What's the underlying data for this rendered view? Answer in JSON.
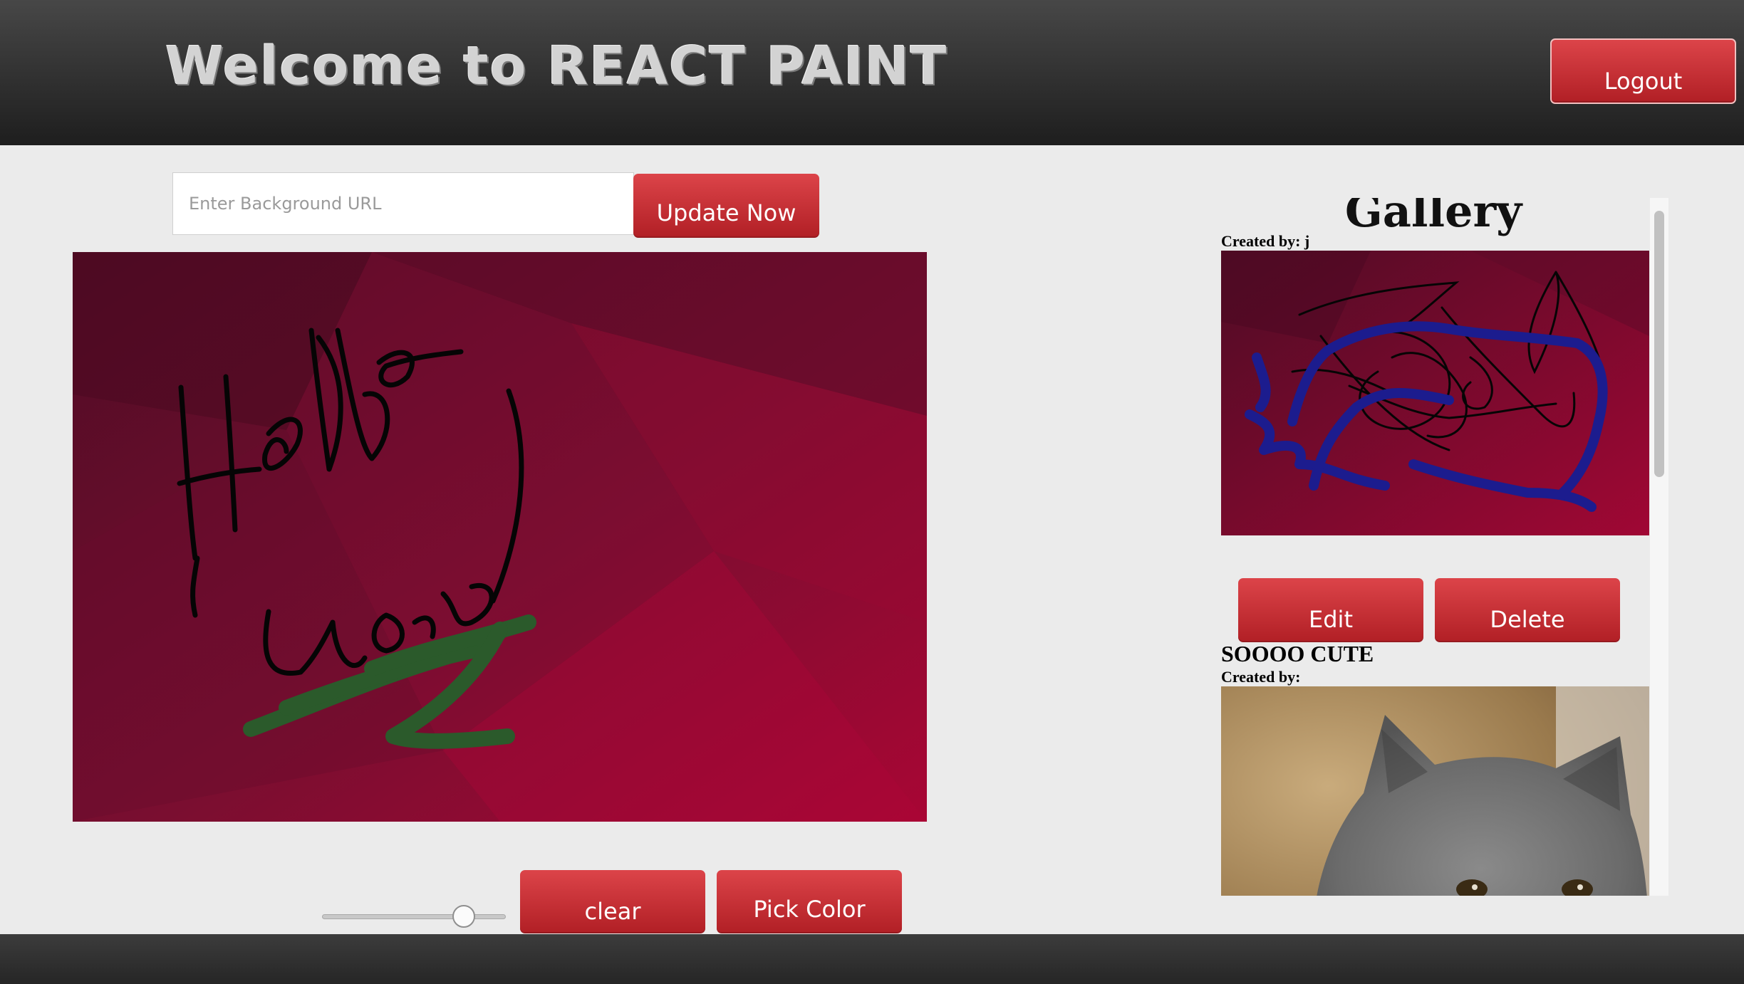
{
  "header": {
    "title": "Welcome to REACT PAINT",
    "logout_label": "Logout"
  },
  "toolbar": {
    "bg_url_placeholder": "Enter Background URL",
    "update_label": "Update Now",
    "clear_label": "clear",
    "pick_color_label": "Pick Color",
    "brush_size_fraction": 0.78
  },
  "gallery": {
    "title": "Gallery",
    "edit_label": "Edit",
    "delete_label": "Delete",
    "items": [
      {
        "title": "",
        "created_by": "Created by: j"
      },
      {
        "title": "SOOOO CUTE",
        "created_by": "Created by:"
      }
    ]
  },
  "colors": {
    "accent": "#c9262c",
    "ink": "#111111",
    "green_stroke": "#2a5a2a",
    "blue_stroke": "#1c1c8e"
  }
}
